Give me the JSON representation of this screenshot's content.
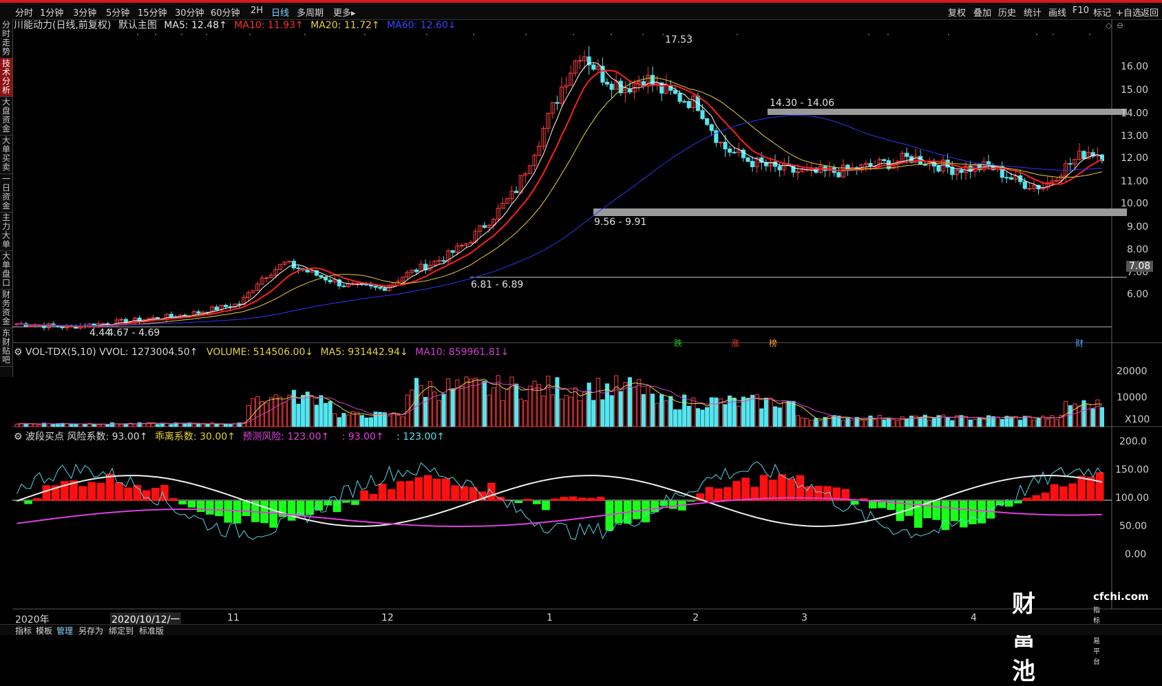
{
  "toolbar": {
    "left_items": [
      "分时",
      "1分钟",
      "3分钟",
      "5分钟",
      "15分钟",
      "30分钟",
      "60分钟",
      "2H",
      "日线",
      "多周期",
      "更多▸"
    ],
    "active": "日线",
    "right_items": [
      "复权",
      "叠加",
      "历史",
      "统计",
      "画线",
      "F10",
      "标记",
      "+自选",
      "返回"
    ]
  },
  "leftnav": [
    "分时走势",
    "技术分析",
    "大盘资金",
    "大单买卖",
    "一日资金",
    "主力大单",
    "大单盘口",
    "财务资金",
    "东财贴吧"
  ],
  "leftnav_active": "技术分析",
  "main": {
    "title": "川能动力(日线,前复权)",
    "mode": "默认主图",
    "ma5": "MA5: 12.48↑",
    "ma10": "MA10: 11.93↑",
    "ma20": "MA20: 11.72↑",
    "ma60": "MA60: 12.60↓",
    "price_ticks": [
      "16.00",
      "15.00",
      "14.00",
      "13.00",
      "12.00",
      "11.00",
      "10.00",
      "9.00",
      "8.00",
      "7.00",
      "6.00"
    ],
    "current_price_tag": "7.08",
    "annotations": {
      "high": "17.53",
      "zone1": "14.30 - 14.06",
      "zone2": "9.56 - 9.91",
      "zone3": "6.81 - 6.89",
      "low1": "4.44",
      "low2": "4.67 - 4.69"
    },
    "markers": [
      {
        "label": "跌",
        "color": "#19c519"
      },
      {
        "label": "涨",
        "color": "#ff3333"
      },
      {
        "label": "榜",
        "color": "#ff9933"
      },
      {
        "label": "财",
        "color": "#4fa3ff"
      }
    ],
    "colors": {
      "up": "#ff3d3d",
      "down": "#54e6f0",
      "ma5": "#ffffff",
      "ma10": "#ff2020",
      "ma20": "#e6d23a",
      "ma60": "#2f35ff"
    }
  },
  "volume": {
    "title": "VOL-TDX(5,10) VVOL: 1273004.50↑",
    "volume": "VOLUME: 514506.00↓",
    "ma5": "MA5: 931442.94↓",
    "ma10": "MA10: 859961.81↓",
    "ticks": [
      "20000",
      "10000",
      "X100"
    ]
  },
  "indicator": {
    "title": "波段买点 风险系数: 93.00↑",
    "deviation": "乖离系数: 30.00↑",
    "forecast": "预测风险: 123.00↑",
    "v1": ": 93.00↑",
    "v2": ": 123.00↑",
    "ticks": [
      "200.0",
      "150.00",
      "100.00",
      "50.00",
      "0.00"
    ]
  },
  "xaxis": {
    "labels": [
      "2020年",
      "2020/10/12/一",
      "11",
      "12",
      "1",
      "2",
      "3",
      "4"
    ]
  },
  "bottombar": {
    "items": [
      "指标",
      "模板",
      "管理",
      "另存为",
      "绑定到",
      "标准版"
    ],
    "active": "管理"
  },
  "watermark": {
    "brand": "财富池",
    "url": "cfchi.com",
    "sub": "指标交易平台"
  }
}
